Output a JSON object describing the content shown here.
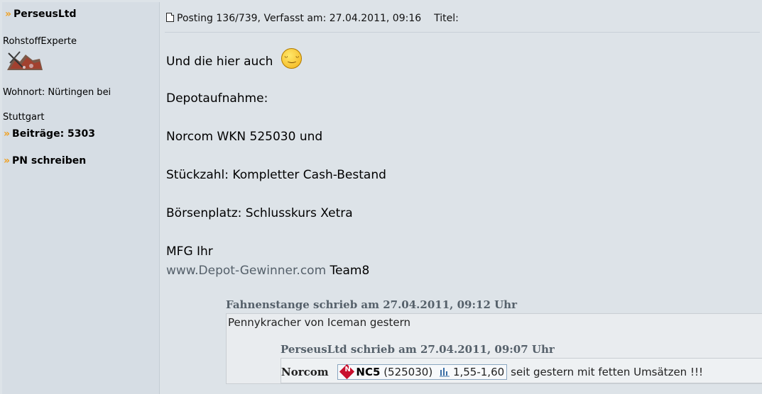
{
  "sidebar": {
    "author": "PerseusLtd",
    "rank": "RohstoffExperte",
    "location_line1": "Wohnort: Nürtingen bei",
    "location_line2": "Stuttgart",
    "posts_label": "Beiträge: 5303",
    "pm_label": "PN schreiben",
    "bullet": "»"
  },
  "post": {
    "meta": "Posting 136/739, Verfasst am: 27.04.2011, 09:16",
    "title_label": "Titel:",
    "line1": "Und die hier auch",
    "line2": "Depotaufnahme:",
    "line3": "Norcom WKN 525030 und",
    "line4": "Stückzahl: Kompletter Cash-Bestand",
    "line5": "Börsenplatz: Schlusskurs Xetra",
    "line6": "MFG Ihr",
    "link": "www.Depot-Gewinner.com",
    "signature_suffix": " Team8"
  },
  "quote1": {
    "header": "Fahnenstange schrieb am 27.04.2011, 09:12 Uhr",
    "text": "Pennykracher von Iceman gestern"
  },
  "quote2": {
    "header": "PerseusLtd schrieb am 27.04.2011, 09:07 Uhr",
    "company": "Norcom",
    "symbol": "NC5",
    "wkn": "(525030)",
    "price": "1,55-1,60",
    "comment": "seit gestern mit fetten Umsätzen !!!"
  },
  "icons": [
    "doc-icon",
    "smiley-icon",
    "stock-logo-icon",
    "chart-icon",
    "avatar-image"
  ],
  "colors": {
    "link": "#55606a",
    "bullet": "#f0a020",
    "sidebar_bg": "#d6dde4",
    "content_bg": "#dde3e8",
    "quote_header": "#55606a"
  }
}
